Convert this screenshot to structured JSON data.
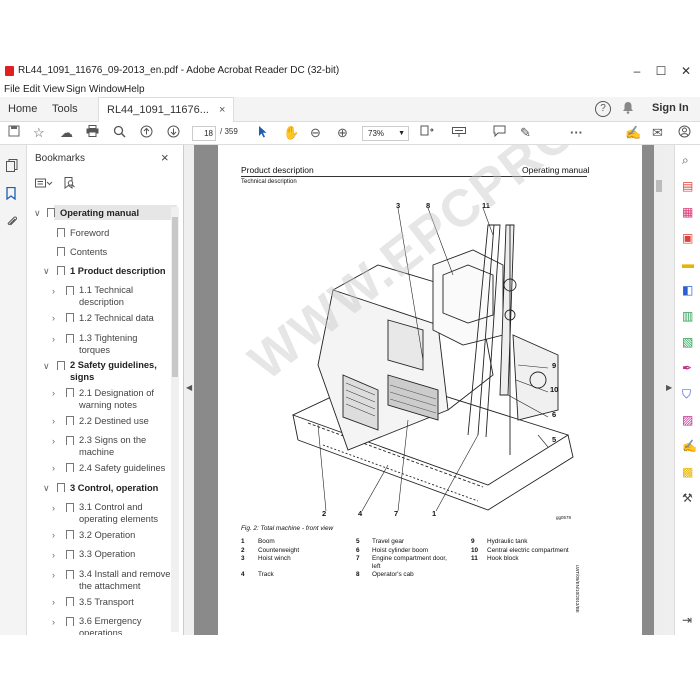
{
  "window": {
    "title": "RL44_1091_11676_09-2013_en.pdf - Adobe Acrobat Reader DC (32-bit)",
    "minimize": "–",
    "maximize": "☐",
    "close": "✕"
  },
  "menu": [
    "File",
    "Edit",
    "View",
    "Sign",
    "Window",
    "Help"
  ],
  "tabs": {
    "home": "Home",
    "tools": "Tools",
    "document": "RL44_1091_11676...",
    "close": "×"
  },
  "header_right": {
    "help": "?",
    "sign_in": "Sign In"
  },
  "toolbar": {
    "page_current": "18",
    "page_total": "/ 359",
    "zoom": "73%",
    "more": "···"
  },
  "bookmarks_panel": {
    "title": "Bookmarks",
    "close": "×",
    "items": [
      {
        "label": "Operating manual",
        "level": 0,
        "expanded": true,
        "bold": true
      },
      {
        "label": "Foreword",
        "level": 1
      },
      {
        "label": "Contents",
        "level": 1
      },
      {
        "label": "1 Product description",
        "level": 1,
        "expanded": true,
        "bold": true
      },
      {
        "label": "1.1 Technical description",
        "level": 2
      },
      {
        "label": "1.2 Technical data",
        "level": 2
      },
      {
        "label": "1.3 Tightening torques",
        "level": 2
      },
      {
        "label": "2 Safety guidelines, signs",
        "level": 1,
        "expanded": true,
        "bold": true
      },
      {
        "label": "2.1 Designation of warning notes",
        "level": 2
      },
      {
        "label": "2.2 Destined use",
        "level": 2
      },
      {
        "label": "2.3 Signs on the machine",
        "level": 2
      },
      {
        "label": "2.4 Safety guidelines",
        "level": 2
      },
      {
        "label": "3 Control, operation",
        "level": 1,
        "expanded": true,
        "bold": true
      },
      {
        "label": "3.1 Control and operating elements",
        "level": 2
      },
      {
        "label": "3.2 Operation",
        "level": 2
      },
      {
        "label": "3.3 Operation",
        "level": 2
      },
      {
        "label": "3.4 Install and remove the attachment",
        "level": 2
      },
      {
        "label": "3.5 Transport",
        "level": 2
      },
      {
        "label": "3.6 Emergency operations",
        "level": 2
      }
    ]
  },
  "document_page": {
    "header_left": "Product description",
    "header_right": "Operating manual",
    "subheader": "Technical description",
    "figure_caption": "Fig. 2: Total machine - front view",
    "figure_code": "gg0579",
    "callouts": [
      "3",
      "8",
      "11",
      "9",
      "10",
      "6",
      "5",
      "2",
      "4",
      "7",
      "1"
    ],
    "legend": [
      {
        "n": "1",
        "t": "Boom"
      },
      {
        "n": "2",
        "t": "Counterweight"
      },
      {
        "n": "3",
        "t": "Hoist winch"
      },
      {
        "n": "4",
        "t": "Track"
      },
      {
        "n": "5",
        "t": "Travel gear"
      },
      {
        "n": "6",
        "t": "Hoist cylinder boom"
      },
      {
        "n": "7",
        "t": "Engine compartment door, left"
      },
      {
        "n": "8",
        "t": "Operator's cab"
      },
      {
        "n": "9",
        "t": "Hydraulic tank"
      },
      {
        "n": "10",
        "t": "Central electric compartment"
      },
      {
        "n": "11",
        "t": "Hook block"
      }
    ],
    "side_code": "LWT/09/EN/10/2013/BE",
    "watermark": "WWW.EPCPRO.COM"
  }
}
